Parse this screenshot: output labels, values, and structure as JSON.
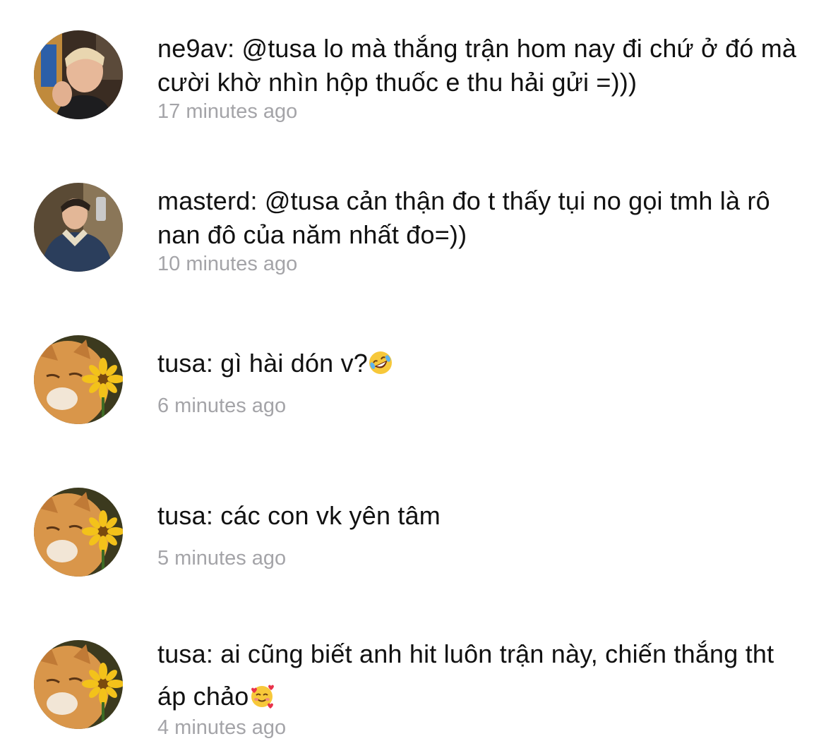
{
  "comments": [
    {
      "avatar": "young-man-selfie-avatar",
      "text": "ne9av: @tusa lo mà thắng trận hom nay đi chứ ở đó mà cười khờ nhìn hộp thuốc e thu hải gửi =)))",
      "time": "17 minutes ago"
    },
    {
      "avatar": "man-mirror-selfie-avatar",
      "text": "masterd: @tusa cản thận đo t thấy tụi no gọi tmh là rô nan đô của năm nhất đo=))",
      "time": "10 minutes ago"
    },
    {
      "avatar": "orange-cat-flower-avatar",
      "text": "tusa: gì hài dón v?",
      "emoji": "rolling-on-floor-laughing-emoji",
      "time": "6 minutes ago"
    },
    {
      "avatar": "orange-cat-flower-avatar",
      "text": "tusa: các con vk yên tâm",
      "time": "5 minutes ago"
    },
    {
      "avatar": "orange-cat-flower-avatar",
      "text": "tusa: ai cũng biết anh hit luôn trận này, chiến thắng tht áp chảo",
      "emoji": "smiling-face-with-hearts-emoji",
      "time": "4 minutes ago"
    }
  ]
}
